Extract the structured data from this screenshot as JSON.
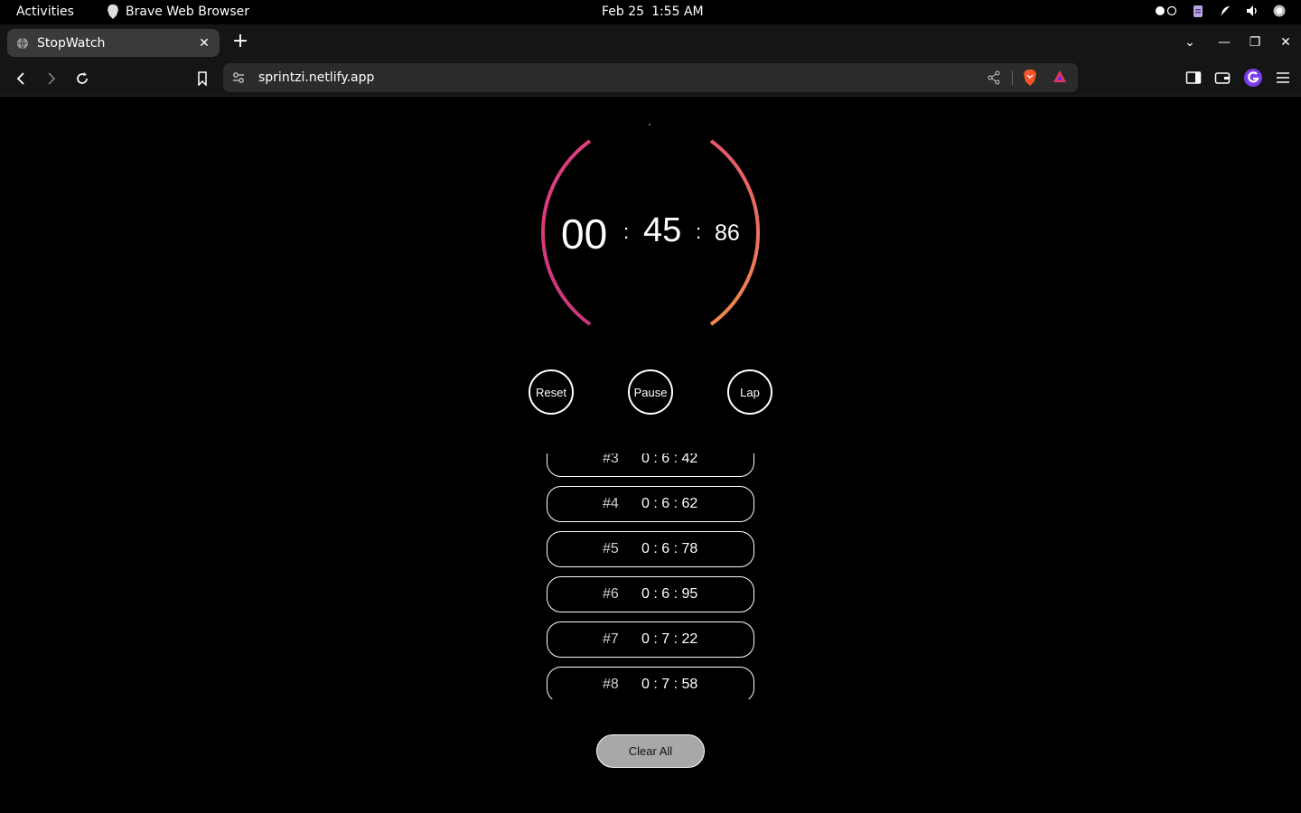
{
  "system_bar": {
    "activities": "Activities",
    "app_name": "Brave Web Browser",
    "date": "Feb 25",
    "time": "1:55 AM"
  },
  "browser": {
    "tab_title": "StopWatch",
    "url": "sprintzi.netlify.app"
  },
  "stopwatch": {
    "minutes": "00",
    "seconds": "45",
    "milliseconds": "86",
    "separator": ":",
    "ring_gradient": [
      "#e0407e",
      "#f08a4b"
    ]
  },
  "controls": {
    "reset_label": "Reset",
    "pause_label": "Pause",
    "lap_label": "Lap"
  },
  "laps": [
    {
      "num": "#3",
      "time": "0 : 6 : 42"
    },
    {
      "num": "#4",
      "time": "0 : 6 : 62"
    },
    {
      "num": "#5",
      "time": "0 : 6 : 78"
    },
    {
      "num": "#6",
      "time": "0 : 6 : 95"
    },
    {
      "num": "#7",
      "time": "0 : 7 : 22"
    },
    {
      "num": "#8",
      "time": "0 : 7 : 58"
    }
  ],
  "clear_all_label": "Clear All"
}
